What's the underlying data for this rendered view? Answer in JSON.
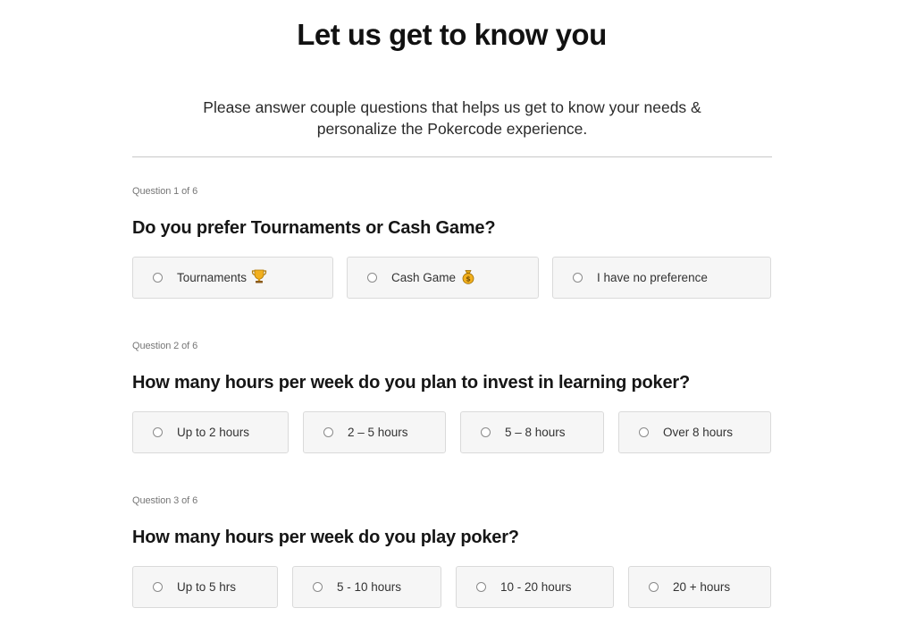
{
  "header": {
    "title": "Let us get to know you",
    "intro_line1": "Please answer couple questions that helps us get to know your needs &",
    "intro_line2": "personalize the Pokercode experience."
  },
  "questions": [
    {
      "counter": "Question 1 of 6",
      "text": "Do you prefer Tournaments or Cash Game?",
      "options": [
        {
          "label": "Tournaments",
          "icon": "trophy-icon"
        },
        {
          "label": "Cash Game",
          "icon": "money-bag-icon"
        },
        {
          "label": "I have no preference"
        }
      ]
    },
    {
      "counter": "Question 2 of 6",
      "text": "How many hours per week do you plan to invest in learning poker?",
      "options": [
        {
          "label": "Up to 2 hours"
        },
        {
          "label": "2 – 5 hours"
        },
        {
          "label": "5 – 8 hours"
        },
        {
          "label": "Over 8 hours"
        }
      ]
    },
    {
      "counter": "Question 3 of 6",
      "text": "How many hours per week do you play poker?",
      "options": [
        {
          "label": "Up to 5 hrs"
        },
        {
          "label": "5 - 10 hours"
        },
        {
          "label": "10 - 20 hours"
        },
        {
          "label": "20 + hours"
        }
      ]
    }
  ],
  "colors": {
    "option_bg": "#f6f6f6",
    "option_border": "#dadada",
    "emoji_gold": "#f2b01e"
  }
}
